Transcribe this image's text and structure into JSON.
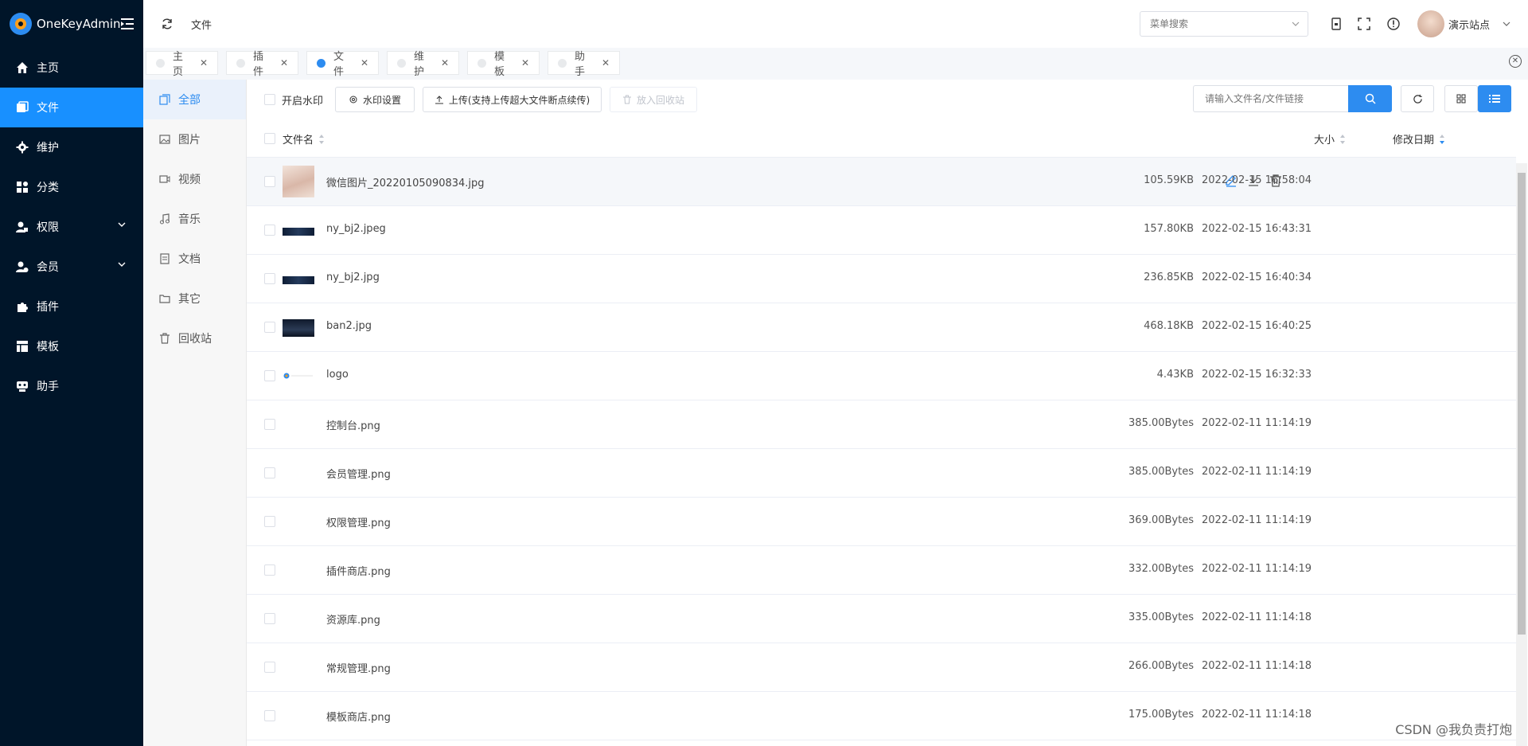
{
  "app": {
    "title": "OneKeyAdmin"
  },
  "sidebar": {
    "items": [
      {
        "label": "主页",
        "icon": "home-icon"
      },
      {
        "label": "文件",
        "icon": "file-icon",
        "active": true
      },
      {
        "label": "维护",
        "icon": "gear-icon"
      },
      {
        "label": "分类",
        "icon": "grid-icon"
      },
      {
        "label": "权限",
        "icon": "user-lock-icon",
        "has_children": true
      },
      {
        "label": "会员",
        "icon": "users-icon",
        "has_children": true
      },
      {
        "label": "插件",
        "icon": "puzzle-icon"
      },
      {
        "label": "模板",
        "icon": "template-icon"
      },
      {
        "label": "助手",
        "icon": "robot-icon"
      }
    ]
  },
  "header": {
    "breadcrumb": "文件",
    "menu_search_placeholder": "菜单搜索",
    "user_name": "演示站点"
  },
  "tabs": [
    {
      "label": "主页",
      "active": false
    },
    {
      "label": "插件",
      "active": false
    },
    {
      "label": "文件",
      "active": true
    },
    {
      "label": "维护",
      "active": false
    },
    {
      "label": "模板",
      "active": false
    },
    {
      "label": "助手",
      "active": false
    }
  ],
  "categories": [
    {
      "label": "全部",
      "active": true
    },
    {
      "label": "图片"
    },
    {
      "label": "视频"
    },
    {
      "label": "音乐"
    },
    {
      "label": "文档"
    },
    {
      "label": "其它"
    },
    {
      "label": "回收站"
    }
  ],
  "toolbar": {
    "watermark_label": "开启水印",
    "watermark_settings": "水印设置",
    "upload": "上传(支持上传超大文件断点续传)",
    "recycle": "放入回收站",
    "search_placeholder": "请输入文件名/文件链接"
  },
  "table": {
    "columns": {
      "name": "文件名",
      "size": "大小",
      "date": "修改日期"
    },
    "rows": [
      {
        "name": "微信图片_20220105090834.jpg",
        "size": "105.59KB",
        "date": "2022-02-15 16:58:04",
        "thumb": "portrait"
      },
      {
        "name": "ny_bj2.jpeg",
        "size": "157.80KB",
        "date": "2022-02-15 16:43:31",
        "thumb": "dark-banner"
      },
      {
        "name": "ny_bj2.jpg",
        "size": "236.85KB",
        "date": "2022-02-15 16:40:34",
        "thumb": "dark-banner"
      },
      {
        "name": "ban2.jpg",
        "size": "468.18KB",
        "date": "2022-02-15 16:40:25",
        "thumb": "dark-photo"
      },
      {
        "name": "logo",
        "size": "4.43KB",
        "date": "2022-02-15 16:32:33",
        "thumb": "logo"
      },
      {
        "name": "控制台.png",
        "size": "385.00Bytes",
        "date": "2022-02-11 11:14:19",
        "thumb": "none"
      },
      {
        "name": "会员管理.png",
        "size": "385.00Bytes",
        "date": "2022-02-11 11:14:19",
        "thumb": "none"
      },
      {
        "name": "权限管理.png",
        "size": "369.00Bytes",
        "date": "2022-02-11 11:14:19",
        "thumb": "none"
      },
      {
        "name": "插件商店.png",
        "size": "332.00Bytes",
        "date": "2022-02-11 11:14:19",
        "thumb": "none"
      },
      {
        "name": "资源库.png",
        "size": "335.00Bytes",
        "date": "2022-02-11 11:14:18",
        "thumb": "none"
      },
      {
        "name": "常规管理.png",
        "size": "266.00Bytes",
        "date": "2022-02-11 11:14:18",
        "thumb": "none"
      },
      {
        "name": "模板商店.png",
        "size": "175.00Bytes",
        "date": "2022-02-11 11:14:18",
        "thumb": "none"
      }
    ]
  },
  "watermark_text": "CSDN @我负责打炮",
  "colors": {
    "sidebar": "#001529",
    "primary": "#2d8cf0",
    "active_menu": "#1890ff"
  }
}
